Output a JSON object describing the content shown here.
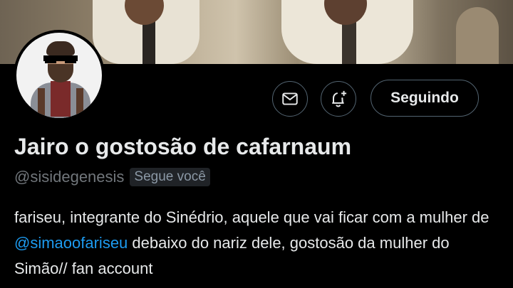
{
  "profile": {
    "display_name": "Jairo o gostosão de cafarnaum",
    "handle": "@sisidegenesis",
    "follows_you_badge": "Segue você",
    "bio_part1": "fariseu, integrante do Sinédrio, aquele que vai ficar com a mulher de ",
    "bio_mention": "@simaoofariseu",
    "bio_part2": " debaixo do nariz dele, gostosão da mulher do Simão// fan account"
  },
  "actions": {
    "message_icon": "mail-icon",
    "notify_icon": "bell-plus-icon",
    "follow_label": "Seguindo"
  },
  "colors": {
    "background": "#000000",
    "text_primary": "#e7e9ea",
    "text_secondary": "#71767b",
    "mention": "#1d9bf0",
    "button_border": "#536471"
  }
}
